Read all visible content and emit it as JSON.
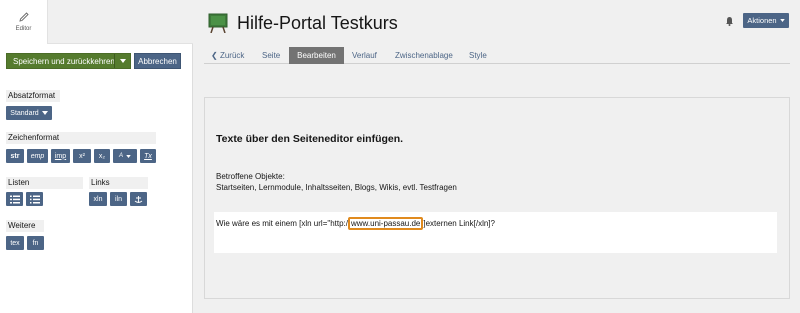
{
  "sidebar": {
    "editor_label": "Editor",
    "save_label": "Speichern und zurückkehren",
    "cancel_label": "Abbrechen",
    "paragraph_format": {
      "title": "Absatzformat",
      "value": "Standard"
    },
    "char_format": {
      "title": "Zeichenformat",
      "buttons": [
        "str",
        "emp",
        "imp",
        "x²",
        "x₂",
        "A",
        "Tx"
      ]
    },
    "lists": {
      "title": "Listen"
    },
    "links": {
      "title": "Links",
      "buttons": [
        "xln",
        "iln"
      ]
    },
    "more": {
      "title": "Weitere",
      "buttons": [
        "tex",
        "fn"
      ]
    }
  },
  "header": {
    "title": "Hilfe-Portal Testkurs",
    "actions_label": "Aktionen"
  },
  "tabs": [
    "Zurück",
    "Seite",
    "Bearbeiten",
    "Verlauf",
    "Zwischenablage",
    "Style"
  ],
  "content": {
    "heading": "Texte über den Seiteneditor einfügen.",
    "objects_label": "Betroffene Objekte:",
    "objects_list": "Startseiten, Lernmodule, Inhaltsseiten, Blogs, Wikis, evtl. Testfragen",
    "line_before": "Wie wäre es mit einem [xln url=\"http:/",
    "line_highlight": "www.uni-passau.de",
    "line_after": "]externen Link[/xln]?"
  },
  "colors": {
    "save_green": "#557b2e",
    "button_blue": "#4c6586",
    "active_tab": "#737373",
    "highlight_orange": "#e08a1e"
  }
}
